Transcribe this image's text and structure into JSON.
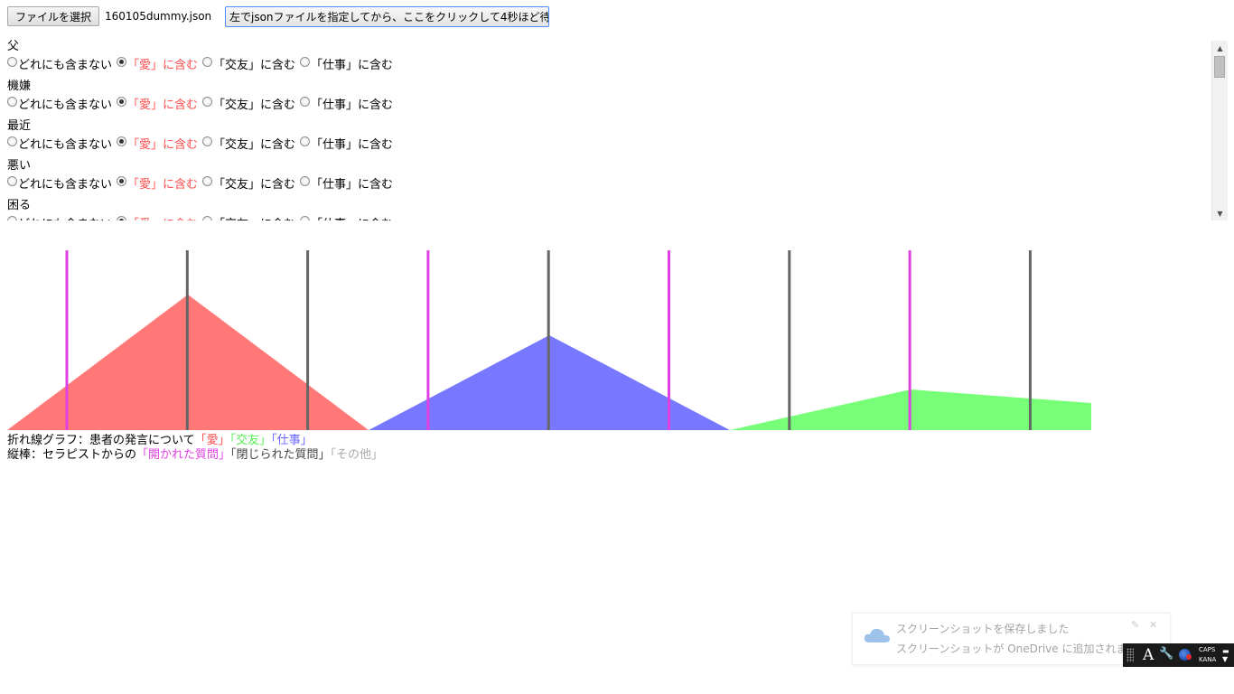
{
  "file_input": {
    "button_label": "ファイルを選択",
    "file_name": "160105dummy.json"
  },
  "load_button": {
    "label": "左でjsonファイルを指定してから、ここをクリックして4秒ほど待つ"
  },
  "options": [
    "どれにも含まない",
    "「愛」に含む",
    "「交友」に含む",
    "「仕事」に含む"
  ],
  "words": [
    {
      "word": "父",
      "selected": 1
    },
    {
      "word": "機嫌",
      "selected": 1
    },
    {
      "word": "最近",
      "selected": 1
    },
    {
      "word": "悪い",
      "selected": 1
    },
    {
      "word": "困る",
      "selected": 1
    }
  ],
  "colors": {
    "love": "#ff7777",
    "friend": "#77ff77",
    "work": "#7777ff",
    "open_question": "#e040e0",
    "closed_question": "#666666",
    "other_question": "#aaaaaa"
  },
  "chart_data": {
    "type": "area",
    "segments": 3,
    "x": [
      0,
      1,
      2
    ],
    "ylim": [
      0,
      1
    ],
    "series": [
      {
        "name": "愛",
        "color": "#ff7777",
        "values": [
          [
            0,
            1,
            0
          ],
          [
            0,
            0.1,
            0
          ],
          [
            0,
            0,
            0
          ]
        ]
      },
      {
        "name": "交友",
        "color": "#77ff77",
        "values": [
          [
            0,
            0,
            0
          ],
          [
            0,
            0,
            0
          ],
          [
            0,
            0.3,
            0.2
          ]
        ]
      },
      {
        "name": "仕事",
        "color": "#7777ff",
        "values": [
          [
            0,
            0,
            0
          ],
          [
            0,
            0.7,
            0
          ],
          [
            0,
            0,
            0
          ]
        ]
      }
    ],
    "questions": [
      {
        "position": 0.5,
        "type": "open"
      },
      {
        "position": 1.5,
        "type": "closed"
      },
      {
        "position": 2.5,
        "type": "closed"
      },
      {
        "position": 3.5,
        "type": "open"
      },
      {
        "position": 4.5,
        "type": "closed"
      },
      {
        "position": 5.5,
        "type": "open"
      },
      {
        "position": 6.5,
        "type": "closed"
      },
      {
        "position": 7.5,
        "type": "open"
      },
      {
        "position": 8.5,
        "type": "closed"
      }
    ]
  },
  "legend": {
    "line1_prefix": "折れ線グラフ：患者の発言について",
    "love": "「愛」",
    "friend": "「交友」",
    "work": "「仕事」",
    "line2_prefix": "縦棒：セラピストからの",
    "open": "「開かれた質問」",
    "closed": "「閉じられた質問」",
    "other": "「その他」"
  },
  "toast": {
    "title": "スクリーンショットを保存しました",
    "body": "スクリーンショットが OneDrive に追加されました"
  },
  "ime": {
    "caps": "CAPS",
    "kana": "KANA",
    "mode": "A"
  }
}
